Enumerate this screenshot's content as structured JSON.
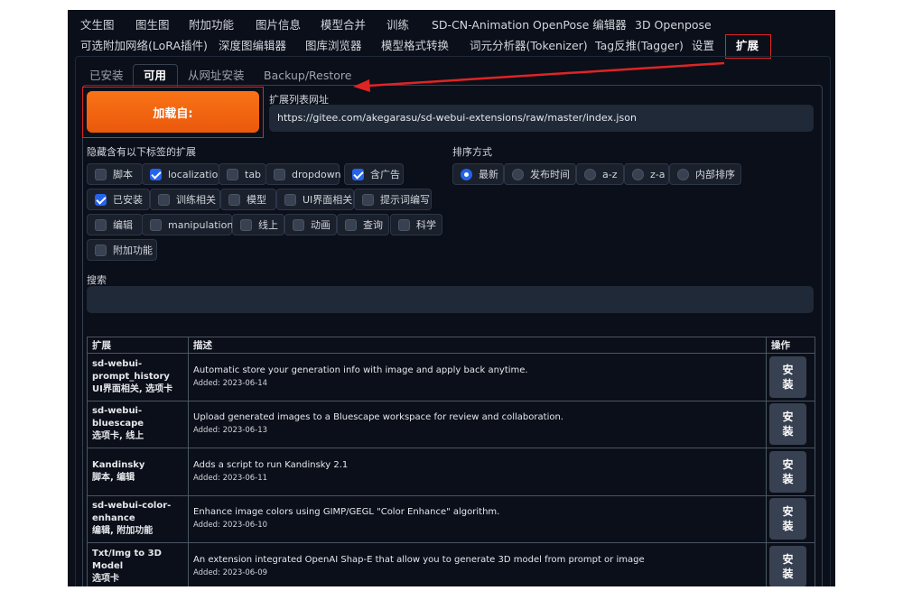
{
  "top_tabs_row1": [
    "文生图",
    "图生图",
    "附加功能",
    "图片信息",
    "模型合并",
    "训练",
    "SD-CN-Animation",
    "OpenPose 编辑器",
    "3D Openpose"
  ],
  "top_tabs_row2": [
    "可选附加网络(LoRA插件)",
    "深度图编辑器",
    "图库浏览器",
    "模型格式转换",
    "词元分析器(Tokenizer)",
    "Tag反推(Tagger)",
    "设置",
    "扩展"
  ],
  "sub_tabs": [
    "已安装",
    "可用",
    "从网址安装",
    "Backup/Restore"
  ],
  "load_button": "加载自:",
  "url_label": "扩展列表网址",
  "url_value": "https://gitee.com/akegarasu/sd-webui-extensions/raw/master/index.json",
  "hide_label": "隐藏含有以下标签的扩展",
  "hide_tags": [
    {
      "label": "脚本",
      "checked": false
    },
    {
      "label": "localization",
      "checked": true
    },
    {
      "label": "tab",
      "checked": false
    },
    {
      "label": "dropdown",
      "checked": false
    },
    {
      "label": "含广告",
      "checked": true
    },
    {
      "label": "已安装",
      "checked": true
    },
    {
      "label": "训练相关",
      "checked": false
    },
    {
      "label": "模型",
      "checked": false
    },
    {
      "label": "UI界面相关",
      "checked": false
    },
    {
      "label": "提示词编写",
      "checked": false
    },
    {
      "label": "编辑",
      "checked": false
    },
    {
      "label": "manipulations",
      "checked": false
    },
    {
      "label": "线上",
      "checked": false
    },
    {
      "label": "动画",
      "checked": false
    },
    {
      "label": "查询",
      "checked": false
    },
    {
      "label": "科学",
      "checked": false
    },
    {
      "label": "附加功能",
      "checked": false
    }
  ],
  "sort_label": "排序方式",
  "sort_options": [
    {
      "label": "最新",
      "selected": true
    },
    {
      "label": "发布时间",
      "selected": false
    },
    {
      "label": "a-z",
      "selected": false
    },
    {
      "label": "z-a",
      "selected": false
    },
    {
      "label": "内部排序",
      "selected": false
    }
  ],
  "search_label": "搜索",
  "table_headers": [
    "扩展",
    "描述",
    "操作"
  ],
  "install_label": "安装",
  "extensions": [
    {
      "name": "sd-webui-prompt_history",
      "tags": "UI界面相关, 选项卡",
      "description": "Automatic store your generation info with image and apply back anytime.",
      "added": "Added: 2023-06-14"
    },
    {
      "name": "sd-webui-bluescape",
      "tags": "选项卡, 线上",
      "description": "Upload generated images to a Bluescape workspace for review and collaboration.",
      "added": "Added: 2023-06-13"
    },
    {
      "name": "Kandinsky",
      "tags": "脚本, 编辑",
      "description": "Adds a script to run Kandinsky 2.1",
      "added": "Added: 2023-06-11"
    },
    {
      "name": "sd-webui-color-enhance",
      "tags": "编辑, 附加功能",
      "description": "Enhance image colors using GIMP/GEGL \"Color Enhance\" algorithm.",
      "added": "Added: 2023-06-10"
    },
    {
      "name": "Txt/Img to 3D Model",
      "tags": "选项卡",
      "description": "An extension integrated OpenAI Shap-E that allow you to generate 3D model from prompt or image",
      "added": "Added: 2023-06-09"
    }
  ],
  "colors": {
    "accent": "#f97316",
    "annotation": "#e02424",
    "checkbox": "#2563eb",
    "background": "#0b0f19"
  }
}
